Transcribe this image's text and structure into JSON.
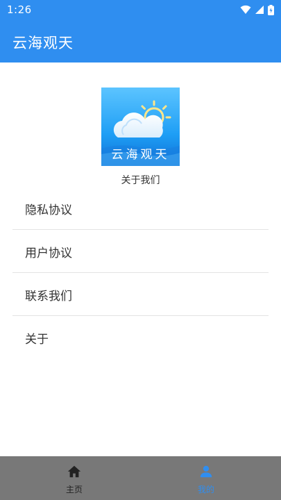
{
  "status_bar": {
    "time": "1:26",
    "icons": [
      "wifi-icon",
      "cell-signal-icon",
      "battery-icon"
    ]
  },
  "app_bar": {
    "title": "云海观天"
  },
  "about": {
    "logo_text": "云海观天",
    "caption": "关于我们"
  },
  "menu": {
    "items": [
      {
        "label": "隐私协议"
      },
      {
        "label": "用户协议"
      },
      {
        "label": "联系我们"
      },
      {
        "label": "关于"
      }
    ]
  },
  "bottom_nav": {
    "items": [
      {
        "label": "主页",
        "icon": "home-icon",
        "active": false
      },
      {
        "label": "我的",
        "icon": "person-icon",
        "active": true
      }
    ]
  },
  "colors": {
    "primary": "#2f8ef0",
    "bottom_nav_bg": "#787878",
    "divider": "#e3e3e3",
    "text": "#333333"
  }
}
